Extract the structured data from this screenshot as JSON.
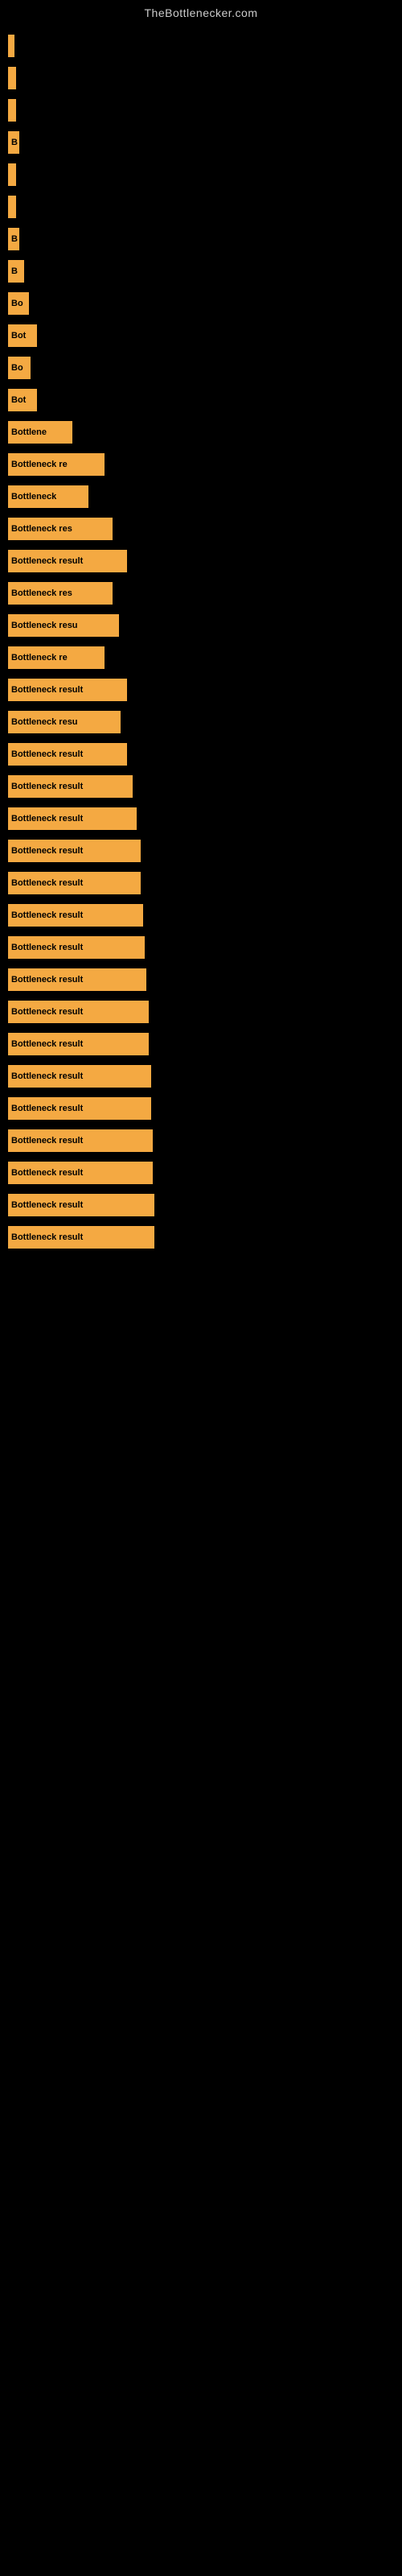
{
  "site": {
    "title": "TheBottlenecker.com"
  },
  "bars": [
    {
      "label": "",
      "width": 8
    },
    {
      "label": "",
      "width": 10
    },
    {
      "label": "",
      "width": 10
    },
    {
      "label": "B",
      "width": 14
    },
    {
      "label": "",
      "width": 10
    },
    {
      "label": "",
      "width": 10
    },
    {
      "label": "B",
      "width": 14
    },
    {
      "label": "B",
      "width": 20
    },
    {
      "label": "Bo",
      "width": 26
    },
    {
      "label": "Bot",
      "width": 36
    },
    {
      "label": "Bo",
      "width": 28
    },
    {
      "label": "Bot",
      "width": 36
    },
    {
      "label": "Bottlene",
      "width": 80
    },
    {
      "label": "Bottleneck re",
      "width": 120
    },
    {
      "label": "Bottleneck",
      "width": 100
    },
    {
      "label": "Bottleneck res",
      "width": 130
    },
    {
      "label": "Bottleneck result",
      "width": 148
    },
    {
      "label": "Bottleneck res",
      "width": 130
    },
    {
      "label": "Bottleneck resu",
      "width": 138
    },
    {
      "label": "Bottleneck re",
      "width": 120
    },
    {
      "label": "Bottleneck result",
      "width": 148
    },
    {
      "label": "Bottleneck resu",
      "width": 140
    },
    {
      "label": "Bottleneck result",
      "width": 148
    },
    {
      "label": "Bottleneck result",
      "width": 155
    },
    {
      "label": "Bottleneck result",
      "width": 160
    },
    {
      "label": "Bottleneck result",
      "width": 165
    },
    {
      "label": "Bottleneck result",
      "width": 165
    },
    {
      "label": "Bottleneck result",
      "width": 168
    },
    {
      "label": "Bottleneck result",
      "width": 170
    },
    {
      "label": "Bottleneck result",
      "width": 172
    },
    {
      "label": "Bottleneck result",
      "width": 175
    },
    {
      "label": "Bottleneck result",
      "width": 175
    },
    {
      "label": "Bottleneck result",
      "width": 178
    },
    {
      "label": "Bottleneck result",
      "width": 178
    },
    {
      "label": "Bottleneck result",
      "width": 180
    },
    {
      "label": "Bottleneck result",
      "width": 180
    },
    {
      "label": "Bottleneck result",
      "width": 182
    },
    {
      "label": "Bottleneck result",
      "width": 182
    }
  ]
}
